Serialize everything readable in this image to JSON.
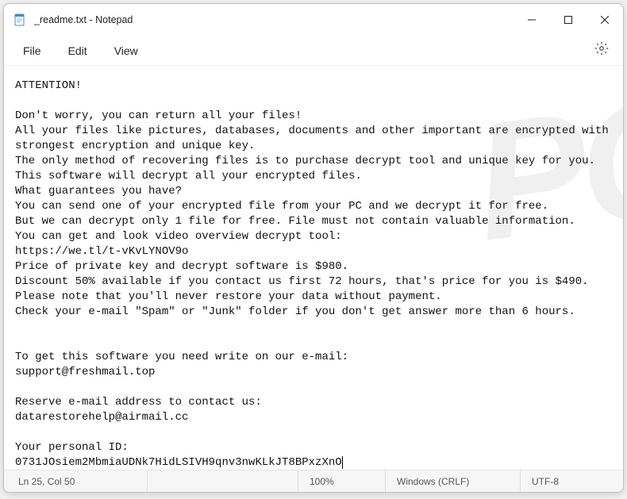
{
  "titlebar": {
    "title": "_readme.txt - Notepad"
  },
  "menu": {
    "file": "File",
    "edit": "Edit",
    "view": "View"
  },
  "content": {
    "lines": [
      "ATTENTION!",
      "",
      "Don't worry, you can return all your files!",
      "All your files like pictures, databases, documents and other important are encrypted with strongest encryption and unique key.",
      "The only method of recovering files is to purchase decrypt tool and unique key for you.",
      "This software will decrypt all your encrypted files.",
      "What guarantees you have?",
      "You can send one of your encrypted file from your PC and we decrypt it for free.",
      "But we can decrypt only 1 file for free. File must not contain valuable information.",
      "You can get and look video overview decrypt tool:",
      "https://we.tl/t-vKvLYNOV9o",
      "Price of private key and decrypt software is $980.",
      "Discount 50% available if you contact us first 72 hours, that's price for you is $490.",
      "Please note that you'll never restore your data without payment.",
      "Check your e-mail \"Spam\" or \"Junk\" folder if you don't get answer more than 6 hours.",
      "",
      "",
      "To get this software you need write on our e-mail:",
      "support@freshmail.top",
      "",
      "Reserve e-mail address to contact us:",
      "datarestorehelp@airmail.cc",
      "",
      "Your personal ID:",
      "0731JOsiem2MbmiaUDNk7HidLSIVH9qnv3nwKLkJT8BPxzXnO"
    ]
  },
  "status": {
    "position": "Ln 25, Col 50",
    "zoom": "100%",
    "lineending": "Windows (CRLF)",
    "encoding": "UTF-8"
  }
}
